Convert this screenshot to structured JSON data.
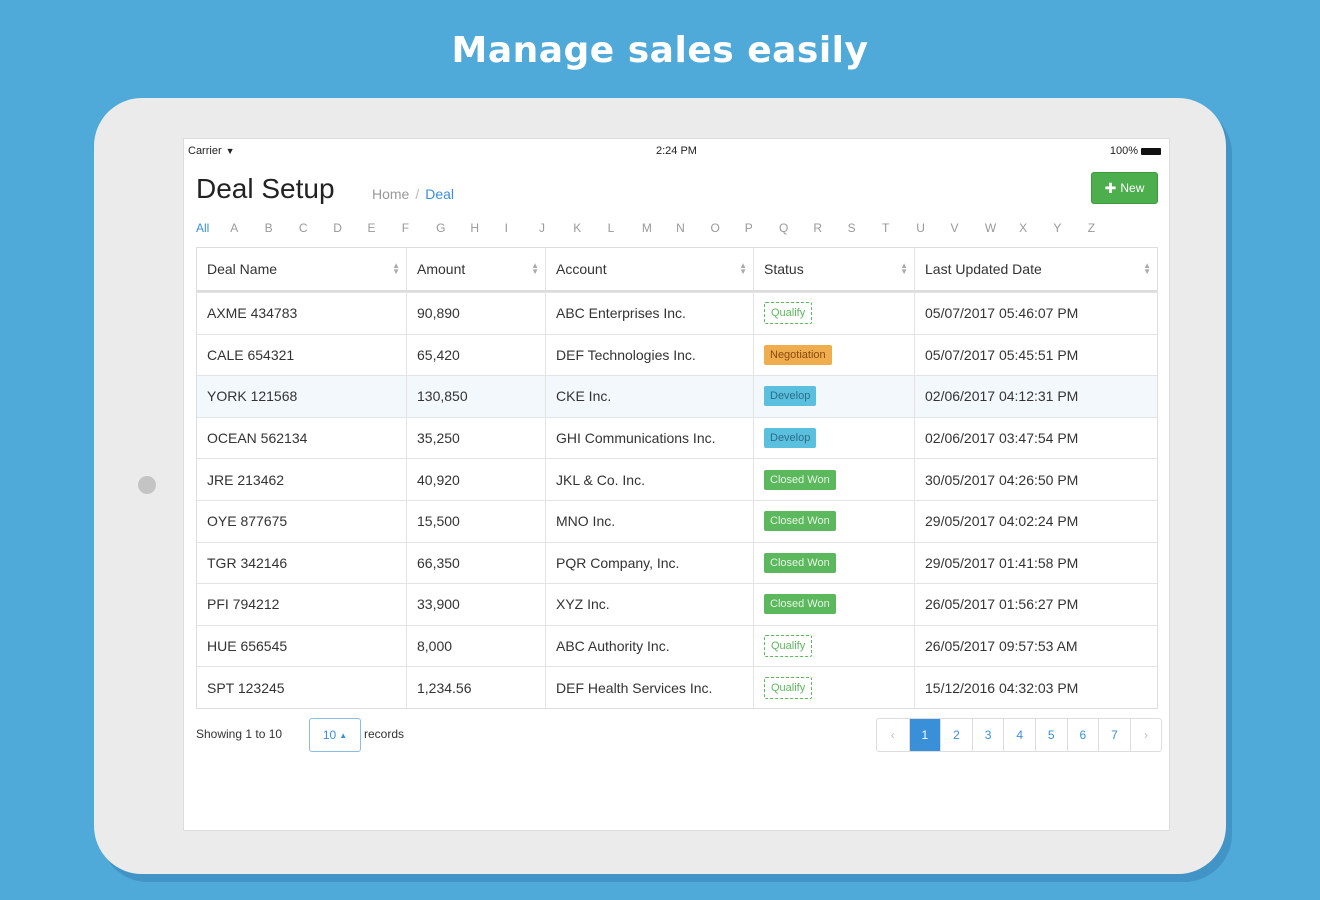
{
  "headline": "Manage sales easily",
  "statusbar": {
    "carrier": "Carrier",
    "time": "2:24 PM",
    "battery": "100%"
  },
  "page": {
    "title": "Deal Setup",
    "breadcrumb": {
      "home": "Home",
      "sep": "/",
      "current": "Deal"
    },
    "new_button": "New"
  },
  "alphabet": [
    "All",
    "A",
    "B",
    "C",
    "D",
    "E",
    "F",
    "G",
    "H",
    "I",
    "J",
    "K",
    "L",
    "M",
    "N",
    "O",
    "P",
    "Q",
    "R",
    "S",
    "T",
    "U",
    "V",
    "W",
    "X",
    "Y",
    "Z"
  ],
  "table": {
    "headers": [
      "Deal Name",
      "Amount",
      "Account",
      "Status",
      "Last Updated Date"
    ],
    "rows": [
      [
        "AXME 434783",
        "90,890",
        "ABC Enterprises Inc.",
        "Qualify",
        "05/07/2017 05:46:07 PM"
      ],
      [
        "CALE 654321",
        "65,420",
        "DEF Technologies Inc.",
        "Negotiation",
        "05/07/2017 05:45:51 PM"
      ],
      [
        "YORK 121568",
        "130,850",
        "CKE Inc.",
        "Develop",
        "02/06/2017 04:12:31 PM"
      ],
      [
        "OCEAN 562134",
        "35,250",
        "GHI Communications Inc.",
        "Develop",
        "02/06/2017 03:47:54 PM"
      ],
      [
        "JRE 213462",
        "40,920",
        "JKL & Co. Inc.",
        "Closed Won",
        "30/05/2017 04:26:50 PM"
      ],
      [
        "OYE 877675",
        "15,500",
        "MNO Inc.",
        "Closed Won",
        "29/05/2017 04:02:24 PM"
      ],
      [
        "TGR 342146",
        "66,350",
        "PQR Company, Inc.",
        "Closed Won",
        "29/05/2017 01:41:58 PM"
      ],
      [
        "PFI 794212",
        "33,900",
        "XYZ Inc.",
        "Closed Won",
        "26/05/2017 01:56:27 PM"
      ],
      [
        "HUE 656545",
        "8,000",
        "ABC Authority Inc.",
        "Qualify",
        "26/05/2017 09:57:53 AM"
      ],
      [
        "SPT 123245",
        "1,234.56",
        "DEF Health Services Inc.",
        "Qualify",
        "15/12/2016 04:32:03 PM"
      ]
    ]
  },
  "footer": {
    "showing": "Showing 1 to 10",
    "page_size": "10",
    "records_label": "records",
    "pages": [
      "‹",
      "1",
      "2",
      "3",
      "4",
      "5",
      "6",
      "7",
      "›"
    ]
  }
}
